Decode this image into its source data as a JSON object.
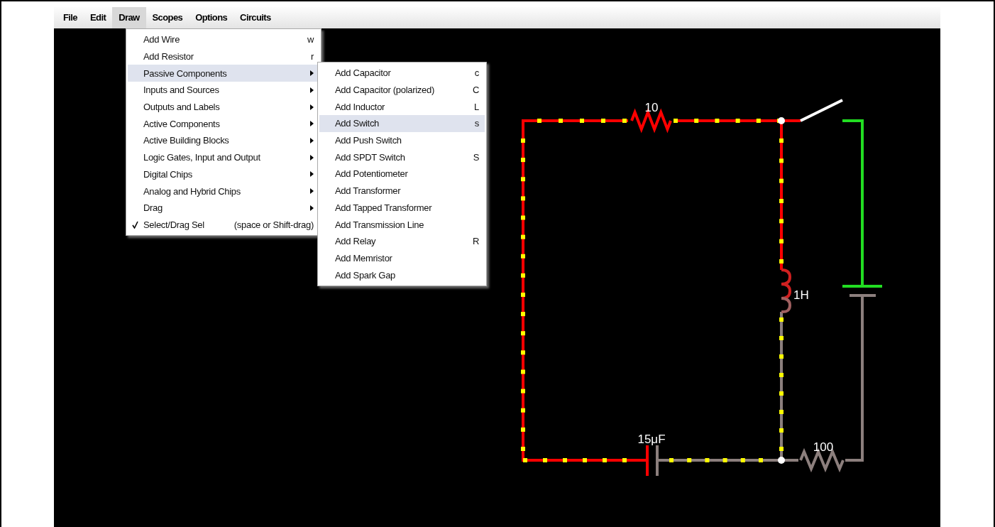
{
  "menubar": [
    {
      "label": "File",
      "selected": false
    },
    {
      "label": "Edit",
      "selected": false
    },
    {
      "label": "Draw",
      "selected": true
    },
    {
      "label": "Scopes",
      "selected": false
    },
    {
      "label": "Options",
      "selected": false
    },
    {
      "label": "Circuits",
      "selected": false
    }
  ],
  "draw_menu": [
    {
      "label": "Add Wire",
      "shortcut": "w",
      "submenu": false,
      "checked": false,
      "selected": false
    },
    {
      "label": "Add Resistor",
      "shortcut": "r",
      "submenu": false,
      "checked": false,
      "selected": false
    },
    {
      "label": "Passive Components",
      "submenu": true,
      "checked": false,
      "selected": true
    },
    {
      "label": "Inputs and Sources",
      "submenu": true,
      "checked": false,
      "selected": false
    },
    {
      "label": "Outputs and Labels",
      "submenu": true,
      "checked": false,
      "selected": false
    },
    {
      "label": "Active Components",
      "submenu": true,
      "checked": false,
      "selected": false
    },
    {
      "label": "Active Building Blocks",
      "submenu": true,
      "checked": false,
      "selected": false
    },
    {
      "label": "Logic Gates, Input and Output",
      "submenu": true,
      "checked": false,
      "selected": false
    },
    {
      "label": "Digital Chips",
      "submenu": true,
      "checked": false,
      "selected": false
    },
    {
      "label": "Analog and Hybrid Chips",
      "submenu": true,
      "checked": false,
      "selected": false
    },
    {
      "label": "Drag",
      "submenu": true,
      "checked": false,
      "selected": false
    },
    {
      "label": "Select/Drag Sel",
      "shortcut": "(space or Shift-drag)",
      "submenu": false,
      "checked": true,
      "selected": false
    }
  ],
  "submenu": [
    {
      "label": "Add Capacitor",
      "shortcut": "c",
      "selected": false
    },
    {
      "label": "Add Capacitor (polarized)",
      "shortcut": "C",
      "selected": false
    },
    {
      "label": "Add Inductor",
      "shortcut": "L",
      "selected": false
    },
    {
      "label": "Add Switch",
      "shortcut": "s",
      "selected": true
    },
    {
      "label": "Add Push Switch",
      "selected": false
    },
    {
      "label": "Add SPDT Switch",
      "shortcut": "S",
      "selected": false
    },
    {
      "label": "Add Potentiometer",
      "selected": false
    },
    {
      "label": "Add Transformer",
      "selected": false
    },
    {
      "label": "Add Tapped Transformer",
      "selected": false
    },
    {
      "label": "Add Transmission Line",
      "selected": false
    },
    {
      "label": "Add Relay",
      "shortcut": "R",
      "selected": false
    },
    {
      "label": "Add Memristor",
      "selected": false
    },
    {
      "label": "Add Spark Gap",
      "selected": false
    }
  ],
  "circuit": {
    "labels": [
      "10",
      "1H",
      "15μF",
      "100"
    ]
  }
}
